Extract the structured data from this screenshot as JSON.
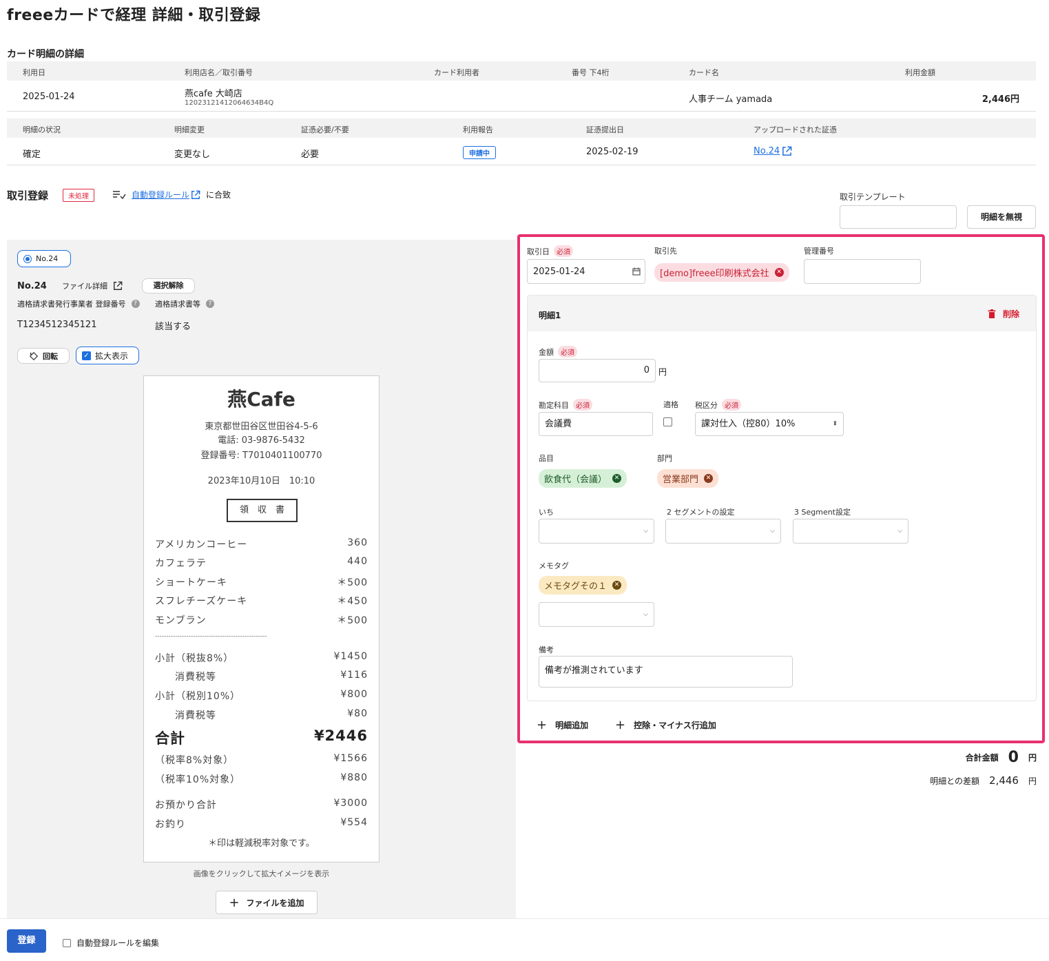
{
  "page_title": "freeeカードで経理 詳細・取引登録",
  "card_detail": {
    "section_title": "カード明細の詳細",
    "headers1": [
      "利用日",
      "利用店名／取引番号",
      "カード利用者",
      "番号 下4桁",
      "カード名",
      "利用金額"
    ],
    "row1": {
      "date": "2025-01-24",
      "store": "燕cafe 大崎店",
      "txn_no": "12023121412064634B4Q",
      "user": "",
      "last4": "",
      "card_name": "人事チーム yamada",
      "amount": "2,446円"
    },
    "headers2": [
      "明細の状況",
      "明細変更",
      "証憑必要/不要",
      "利用報告",
      "証憑提出日",
      "アップロードされた証憑"
    ],
    "row2": {
      "status": "確定",
      "change": "変更なし",
      "evidence_required": "必要",
      "report_badge": "申請中",
      "submit_date": "2025-02-19",
      "uploaded_link": "No.24"
    }
  },
  "registration": {
    "title": "取引登録",
    "status_badge": "未処理",
    "rule_link": "自動登録ルール",
    "rule_suffix": "に合致",
    "template_label": "取引テンプレート",
    "template_value": "",
    "ignore_button": "明細を無視"
  },
  "evidence_panel": {
    "radio_label": "No.24",
    "file_no": "No.24",
    "file_detail": "ファイル詳細",
    "deselect_button": "選択解除",
    "invoice_reg_label": "適格請求書発行事業者 登録番号",
    "invoice_doc_label": "適格請求書等",
    "invoice_reg_value": "T1234512345121",
    "invoice_doc_value": "該当する",
    "rotate_button": "回転",
    "zoom_label": "拡大表示",
    "zoom_checked": true,
    "hint": "画像をクリックして拡大イメージを表示",
    "add_file_button": "ファイルを追加"
  },
  "receipt": {
    "shop": "燕Cafe",
    "address": "東京都世田谷区世田谷4-5-6",
    "phone": "電話: 03-9876-5432",
    "reg_no": "登録番号: T7010401100770",
    "datetime": "2023年10月10日　10:10",
    "doc_title": "領　収　書",
    "items": [
      {
        "name": "アメリカンコーヒー",
        "price": "360"
      },
      {
        "name": "カフェラテ",
        "price": "440"
      },
      {
        "name": "ショートケーキ",
        "price": "＊500"
      },
      {
        "name": "スフレチーズケーキ",
        "price": "＊450"
      },
      {
        "name": "モンブラン",
        "price": "＊500"
      }
    ],
    "divider": "--------------------------------------------------",
    "subtotals": [
      {
        "name": "小計（税抜8%）",
        "price": "¥1450"
      },
      {
        "name": "　消費税等",
        "price": "¥116"
      },
      {
        "name": "小計（税別10%）",
        "price": "¥800"
      },
      {
        "name": "　消費税等",
        "price": "¥80"
      }
    ],
    "total_label": "合計",
    "total_value": "¥2446",
    "tax_breakdown": [
      {
        "name": "（税率8%対象）",
        "price": "¥1566"
      },
      {
        "name": "（税率10%対象）",
        "price": "¥880"
      }
    ],
    "deposit": {
      "name": "お預かり合計",
      "price": "¥3000"
    },
    "change": {
      "name": "お釣り",
      "price": "¥554"
    },
    "note": "＊印は軽減税率対象です。"
  },
  "form": {
    "date_label": "取引日",
    "required": "必須",
    "date_value": "2025-01-24",
    "partner_label": "取引先",
    "partner_value": "[demo]freee印刷株式会社",
    "mgmt_label": "管理番号",
    "mgmt_value": "",
    "line_title": "明細1",
    "delete_label": "削除",
    "amount_label": "金額",
    "amount_value": "0",
    "yen": "円",
    "account_label": "勘定科目",
    "account_value": "会議費",
    "qualified_label": "適格",
    "tax_label": "税区分",
    "tax_value": "課対仕入（控80）10%",
    "item_label": "品目",
    "item_value": "飲食代（会議）",
    "dept_label": "部門",
    "dept_value": "営業部門",
    "seg1_label": "いち",
    "seg2_label": "2 セグメントの設定",
    "seg3_label": "3 Segment設定",
    "memo_label": "メモタグ",
    "memo_value": "メモタグその１",
    "note_label": "備考",
    "note_value": "備考が推測されています",
    "add_line": "明細追加",
    "add_deduct": "控除・マイナス行追加"
  },
  "totals": {
    "total_label": "合計金額",
    "total_value": "0",
    "total_unit": "円",
    "diff_label": "明細との差額",
    "diff_value": "2,446",
    "diff_unit": "円"
  },
  "footer": {
    "register_button": "登録",
    "edit_rule_label": "自動登録ルールを編集"
  },
  "colors": {
    "accent": "#1d6fe0",
    "highlight_border": "#e8306e",
    "required_bg": "#fbdde1",
    "item_chip": "#d6f0d8",
    "dept_chip": "#fde0d4",
    "memo_chip": "#fbe9c2"
  }
}
